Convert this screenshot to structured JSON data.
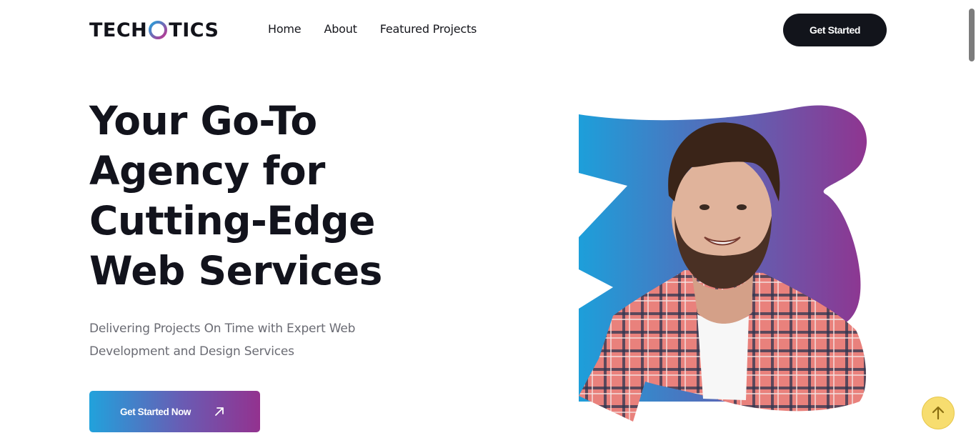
{
  "brand": {
    "logo_left": "TECH",
    "logo_right": "TICS",
    "gradient": [
      "#21a2dc",
      "#93328f"
    ]
  },
  "nav": {
    "items": [
      "Home",
      "About",
      "Featured Projects"
    ]
  },
  "header": {
    "cta_label": "Get Started"
  },
  "hero": {
    "title_lines": [
      "Your Go-To",
      "Agency for",
      "Cutting-Edge",
      "Web Services"
    ],
    "subtitle_lines": [
      "Delivering Projects On Time with Expert Web",
      "Development and Design Services"
    ],
    "cta_label": "Get Started Now",
    "cta_icon": "arrow-up-right-icon",
    "image_alt": "Smiling man in plaid shirt"
  },
  "utility": {
    "scroll_top_icon": "arrow-up-icon"
  },
  "colors": {
    "dark": "#12141b",
    "text_muted": "#6a6b73",
    "accent_blue": "#21a2dc",
    "accent_purple": "#93328f",
    "scroll_top_bg": "#f7dd6f"
  }
}
